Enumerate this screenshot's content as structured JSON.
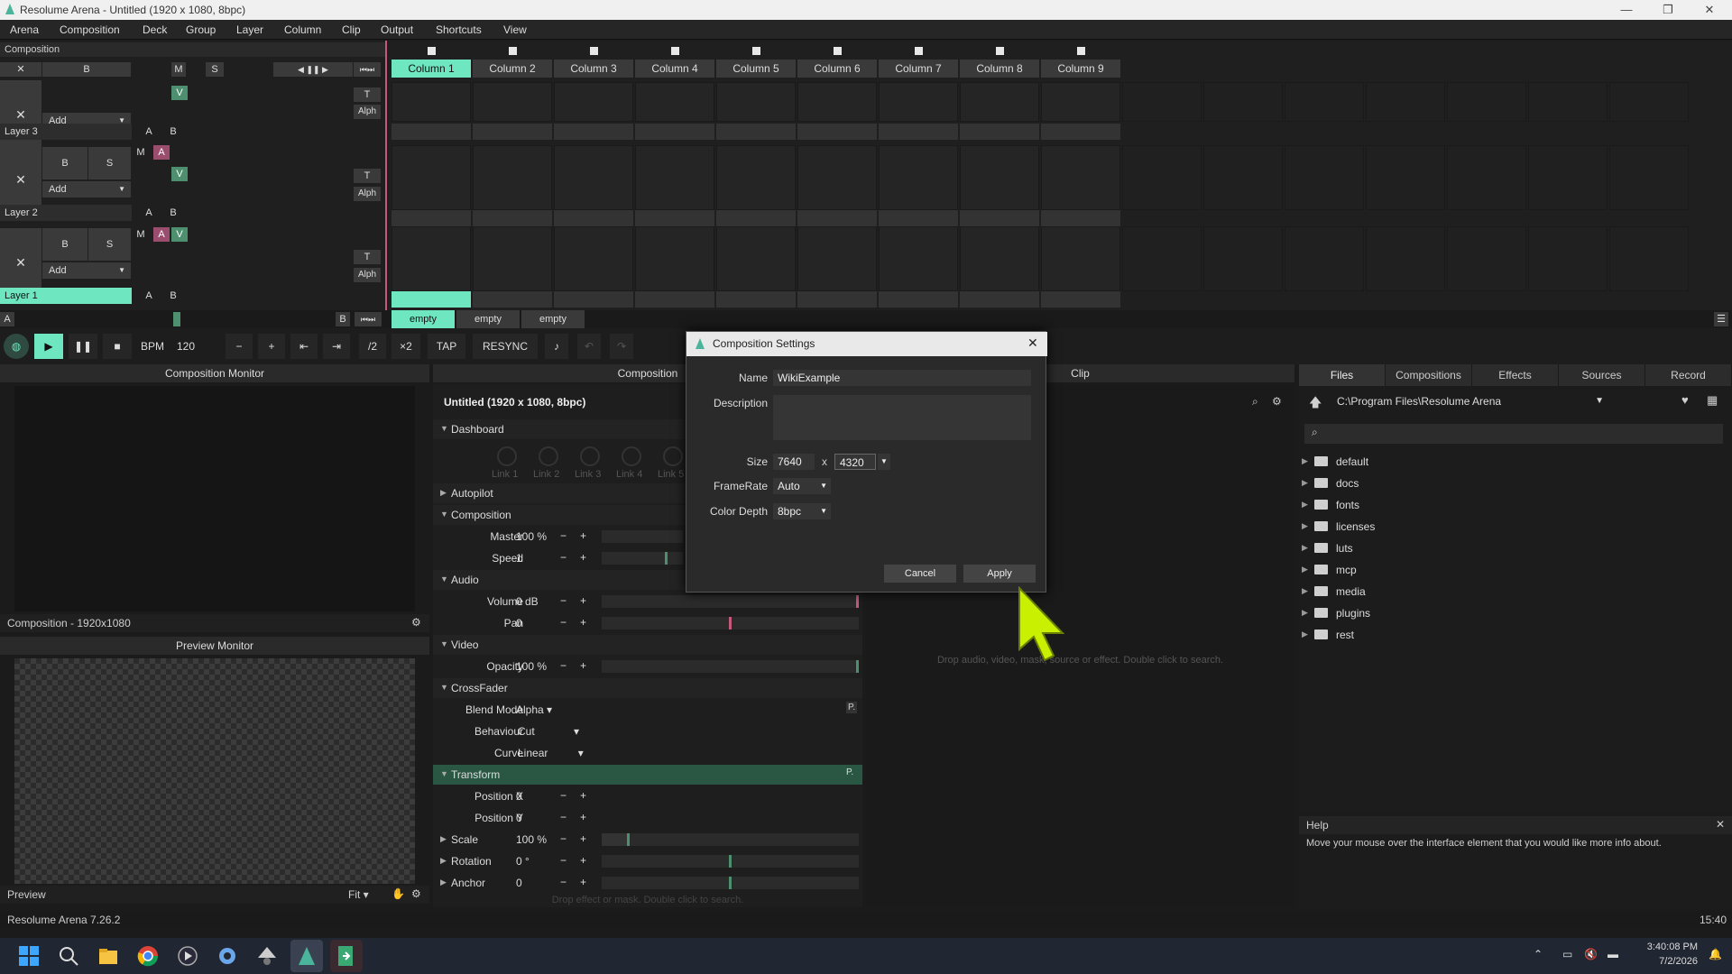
{
  "window": {
    "title": "Resolume Arena - Untitled (1920 x 1080, 8bpc)"
  },
  "menu": [
    "Arena",
    "Composition",
    "Deck",
    "Group",
    "Layer",
    "Column",
    "Clip",
    "Output",
    "Shortcuts",
    "View"
  ],
  "composition_label": "Composition",
  "columns": [
    "Column 1",
    "Column 2",
    "Column 3",
    "Column 4",
    "Column 5",
    "Column 6",
    "Column 7",
    "Column 8",
    "Column 9"
  ],
  "layers": [
    {
      "name": "Layer 3"
    },
    {
      "name": "Layer 2"
    },
    {
      "name": "Layer 1"
    }
  ],
  "layer_controls": {
    "x": "✕",
    "b": "B",
    "s": "S",
    "m": "M",
    "a": "A",
    "v": "V",
    "add": "Add",
    "t": "T",
    "alph": "Alph",
    "ab_a": "A",
    "ab_b": "B"
  },
  "deck_bottom": {
    "a": "A",
    "b": "B",
    "tabs": [
      "empty",
      "empty",
      "empty"
    ]
  },
  "transport": {
    "bpm_label": "BPM",
    "bpm_value": "120",
    "minus": "−",
    "plus": "+",
    "half": "/2",
    "double": "×2",
    "tap": "TAP",
    "resync": "RESYNC"
  },
  "comp_monitor": {
    "title": "Composition Monitor",
    "footer": "Composition - 1920x1080"
  },
  "preview_monitor": {
    "title": "Preview Monitor",
    "footer": "Preview",
    "fit": "Fit"
  },
  "composition_panel": {
    "header": "Composition",
    "title": "Untitled (1920 x 1080, 8bpc)",
    "dashboard": "Dashboard",
    "links": [
      "Link 1",
      "Link 2",
      "Link 3",
      "Link 4",
      "Link 5"
    ],
    "autopilot": "Autopilot",
    "composition_section": "Composition",
    "master_label": "Master",
    "master_value": "100 %",
    "speed_label": "Speed",
    "speed_value": "1",
    "audio": "Audio",
    "volume_label": "Volume",
    "volume_value": "0 dB",
    "pan_label": "Pan",
    "pan_value": "0",
    "video": "Video",
    "opacity_label": "Opacity",
    "opacity_value": "100 %",
    "crossfader": "CrossFader",
    "blend_label": "Blend Mode",
    "blend_value": "Alpha",
    "behaviour_label": "Behaviour",
    "behaviour_value": "Cut",
    "curve_label": "Curve",
    "curve_value": "Linear",
    "transform": "Transform",
    "posx_label": "Position X",
    "posx_value": "0",
    "posy_label": "Position Y",
    "posy_value": "0",
    "scale_label": "Scale",
    "scale_value": "100 %",
    "rotation_label": "Rotation",
    "rotation_value": "0 °",
    "anchor_label": "Anchor",
    "anchor_value": "0",
    "drop_hint": "Drop effect or mask. Double click to search.",
    "p": "P."
  },
  "clip_panel": {
    "header": "Clip",
    "hint": "Drop audio, video, mask, source or effect. Double click to search."
  },
  "dialog": {
    "title": "Composition Settings",
    "name_label": "Name",
    "name_value": "WikiExample",
    "description_label": "Description",
    "size_label": "Size",
    "width": "7640",
    "x": "x",
    "height": "4320",
    "framerate_label": "FrameRate",
    "framerate_value": "Auto",
    "colordepth_label": "Color Depth",
    "colordepth_value": "8bpc",
    "cancel": "Cancel",
    "apply": "Apply"
  },
  "files": {
    "tabs": [
      "Files",
      "Compositions",
      "Effects",
      "Sources",
      "Record"
    ],
    "path": "C:\\Program Files\\Resolume Arena",
    "folders": [
      "default",
      "docs",
      "fonts",
      "licenses",
      "luts",
      "mcp",
      "media",
      "plugins",
      "rest"
    ]
  },
  "help": {
    "title": "Help",
    "text": "Move your mouse over the interface element that you would like more info about."
  },
  "status": {
    "version": "Resolume Arena 7.26.2",
    "time_right": "15:40"
  },
  "taskbar": {
    "time": "3:40:08 PM",
    "date": "7/2/2026"
  },
  "colors": {
    "accent": "#6ee7c0",
    "a_button": "#9b4d6d",
    "v_button": "#4d8f6e",
    "cursor": "#c8f000"
  }
}
